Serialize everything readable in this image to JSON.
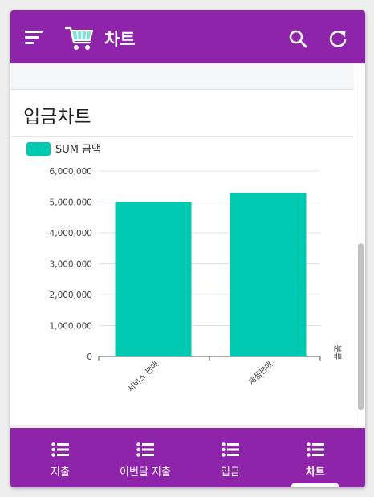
{
  "app": {
    "title": "차트",
    "primary_color": "#8e24aa"
  },
  "icons": {
    "menu": "menu-lines-icon",
    "logo": "shopping-cart-icon",
    "search": "search-icon",
    "refresh": "refresh-icon",
    "nav": "list-bullets-icon"
  },
  "card": {
    "title": "입금차트"
  },
  "chart_data": {
    "type": "bar",
    "categories": [
      "서비스 판매",
      "제품판매"
    ],
    "series": [
      {
        "name": "SUM 금액",
        "values": [
          5000000,
          5300000
        ],
        "color": "#00c9b1"
      }
    ],
    "ylim": [
      0,
      6000000
    ],
    "yticks": [
      0,
      1000000,
      2000000,
      3000000,
      4000000,
      5000000,
      6000000
    ],
    "ytick_labels": [
      "0",
      "1,000,000",
      "2,000,000",
      "3,000,000",
      "4,000,000",
      "5,000,000",
      "6,000,000"
    ],
    "xlabel": "분류",
    "ylabel": "",
    "grid": true,
    "legend": "top-left"
  },
  "bottom_nav": {
    "items": [
      {
        "label": "지출"
      },
      {
        "label": "이번달 지출"
      },
      {
        "label": "입금"
      },
      {
        "label": "차트"
      }
    ],
    "active_index": 3
  }
}
